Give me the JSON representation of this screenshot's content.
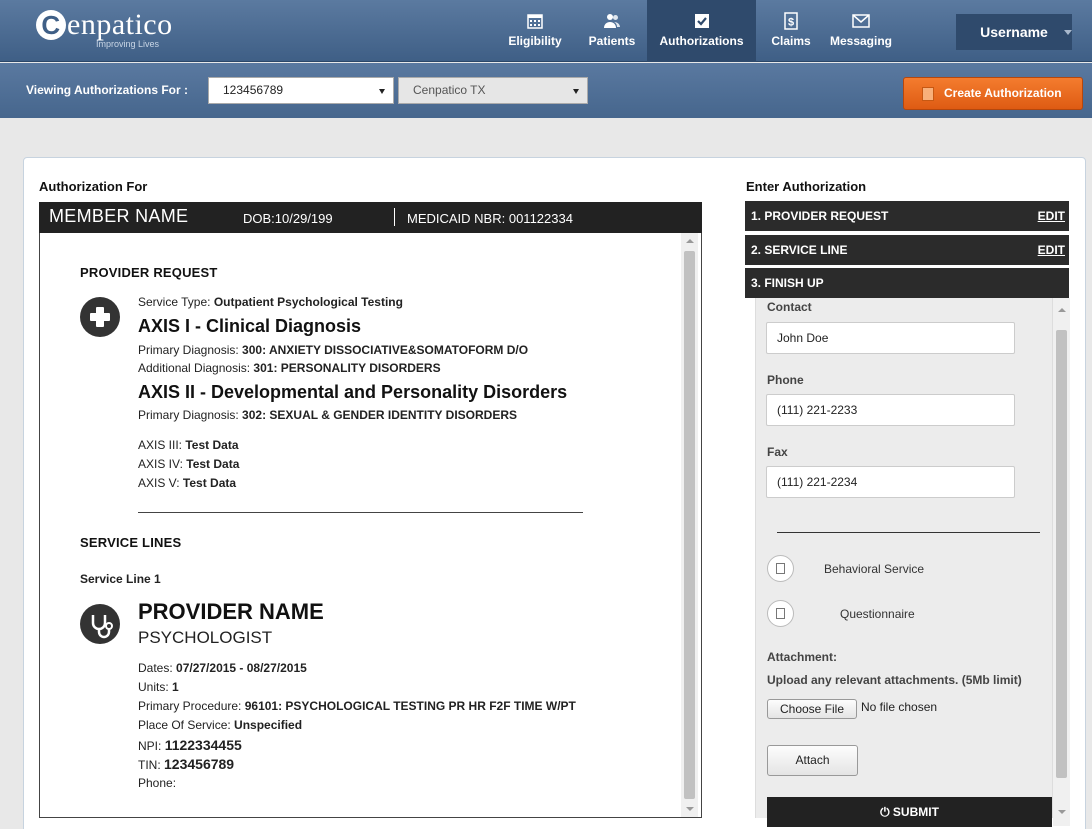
{
  "brand": {
    "name": "enpatico",
    "initial": "C",
    "tagline": "Improving Lives"
  },
  "nav": {
    "items": [
      {
        "label": "Eligibility",
        "icon": "calendar-icon"
      },
      {
        "label": "Patients",
        "icon": "people-icon"
      },
      {
        "label": "Authorizations",
        "icon": "check-icon",
        "active": true
      },
      {
        "label": "Claims",
        "icon": "dollar-icon"
      },
      {
        "label": "Messaging",
        "icon": "envelope-icon"
      }
    ],
    "username": "Username"
  },
  "subbar": {
    "label": "Viewing Authorizations For :",
    "member_id": "123456789",
    "plan": "Cenpatico TX",
    "create_label": "Create Authorization"
  },
  "left": {
    "heading": "Authorization For",
    "member": {
      "name": "MEMBER NAME",
      "dob": "DOB:10/29/199",
      "medicaid": "MEDICAID NBR: 001122334"
    },
    "provider_request": {
      "title": "PROVIDER REQUEST",
      "service_type_label": "Service Type:",
      "service_type": "Outpatient Psychological Testing",
      "axis1_title": "AXIS I - Clinical Diagnosis",
      "axis1_primary_label": "Primary Diagnosis:",
      "axis1_primary": "300: ANXIETY DISSOCIATIVE&SOMATOFORM D/O",
      "axis1_additional_label": "Additional Diagnosis:",
      "axis1_additional": "301: PERSONALITY DISORDERS",
      "axis2_title": "AXIS II - Developmental and Personality Disorders",
      "axis2_primary_label": "Primary Diagnosis:",
      "axis2_primary": "302: SEXUAL & GENDER IDENTITY DISORDERS",
      "axis3_label": "AXIS III:",
      "axis3": "Test Data",
      "axis4_label": "AXIS IV:",
      "axis4": "Test Data",
      "axis5_label": "AXIS V:",
      "axis5": "Test Data"
    },
    "service_lines": {
      "title": "SERVICE LINES",
      "line_title": "Service Line 1",
      "provider_name": "PROVIDER NAME",
      "provider_type": "PSYCHOLOGIST",
      "dates_label": "Dates:",
      "dates": "07/27/2015 - 08/27/2015",
      "units_label": "Units:",
      "units": "1",
      "procedure_label": "Primary Procedure:",
      "procedure": "96101: PSYCHOLOGICAL TESTING PR HR F2F TIME W/PT",
      "pos_label": "Place Of Service:",
      "pos": "Unspecified",
      "npi_label": "NPI:",
      "npi": "1122334455",
      "tin_label": "TIN:",
      "tin": "123456789",
      "phone_label": "Phone:"
    }
  },
  "right": {
    "heading": "Enter Authorization",
    "steps": [
      {
        "label": "1. PROVIDER REQUEST",
        "edit": "EDIT"
      },
      {
        "label": "2. SERVICE LINE",
        "edit": "EDIT"
      },
      {
        "label": "3. FINISH UP"
      }
    ],
    "contact_label": "Contact",
    "contact_value": "John Doe",
    "phone_label": "Phone",
    "phone_value": "(111) 221-2233",
    "fax_label": "Fax",
    "fax_value": "(111) 221-2234",
    "behavioral_label": "Behavioral Service",
    "questionnaire_label": "Questionnaire",
    "attachment_label": "Attachment:",
    "attachment_hint": "Upload any relevant attachments. (5Mb limit)",
    "choose_file_label": "Choose File",
    "no_file_text": "No file chosen",
    "attach_label": "Attach",
    "submit_label": "SUBMIT"
  }
}
